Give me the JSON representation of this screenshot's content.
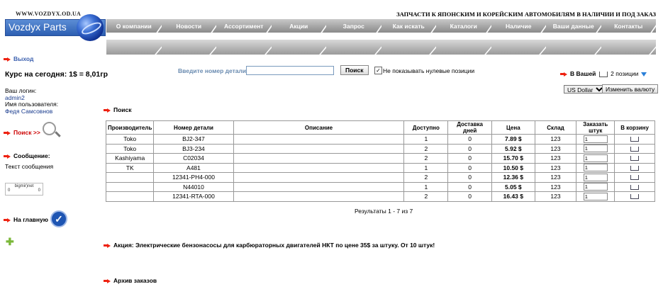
{
  "header": {
    "site_url": "WWW.VOZDYX.OD.UA",
    "tagline": "ЗАПЧАСТИ К ЯПОНСКИМ И КОРЕЙСКИМ АВТОМОБИЛЯМ В НАЛИЧИИ И ПОД ЗАКАЗ",
    "logo_text": "Vozdyx Parts"
  },
  "nav": [
    {
      "label": "О компании"
    },
    {
      "label": "Новости"
    },
    {
      "label": "Ассортимент"
    },
    {
      "label": "Акции"
    },
    {
      "label": "Запрос"
    },
    {
      "label": "Как искать"
    },
    {
      "label": "Каталоги"
    },
    {
      "label": "Наличие"
    },
    {
      "label": "Ваши данные"
    },
    {
      "label": "Контакты"
    }
  ],
  "sidebar": {
    "exit": "Выход",
    "rate": "Курс на сегодня: 1$ = 8,01гр",
    "login_label": "Ваш логин:",
    "login": "admin2",
    "user_label": "Имя пользователя:",
    "user_name": "Федя Самсовнов",
    "search_link": "Поиск >>",
    "message_title": "Сообщение:",
    "message_text": "Текст сообщения",
    "counter_name": "bigmir)net",
    "counter_left": "0",
    "counter_right": "0",
    "home_link": "На главную"
  },
  "searchbar": {
    "label": "Введите номер детали",
    "value": "",
    "button": "Поиск",
    "checkbox_label": "Не показывать нулевые позиции"
  },
  "cart": {
    "label": "В Вашей",
    "count": "2 позиции"
  },
  "currency": {
    "selected": "US Dollar",
    "button": "Изменить валюту"
  },
  "results": {
    "title": "Поиск",
    "columns": {
      "maker": "Производитель",
      "part": "Номер детали",
      "desc": "Описание",
      "avail": "Доступно",
      "delivery": "Доставка дней",
      "price": "Цена",
      "stock": "Склад",
      "order": "Заказать штук",
      "basket": "В корзину"
    },
    "rows": [
      {
        "maker": "Toko",
        "part": "BJ2-347",
        "desc": "",
        "avail": "1",
        "delivery": "0",
        "price": "7.89 $",
        "stock": "123",
        "qty": "1"
      },
      {
        "maker": "Toko",
        "part": "BJ3-234",
        "desc": "",
        "avail": "2",
        "delivery": "0",
        "price": "5.92 $",
        "stock": "123",
        "qty": "1"
      },
      {
        "maker": "Kashiyama",
        "part": "C02034",
        "desc": "",
        "avail": "2",
        "delivery": "0",
        "price": "15.70 $",
        "stock": "123",
        "qty": "1"
      },
      {
        "maker": "TK",
        "part": "A481",
        "desc": "",
        "avail": "1",
        "delivery": "0",
        "price": "10.50 $",
        "stock": "123",
        "qty": "1"
      },
      {
        "maker": "",
        "part": "12341-PH4-000",
        "desc": "",
        "avail": "2",
        "delivery": "0",
        "price": "12.36 $",
        "stock": "123",
        "qty": "1"
      },
      {
        "maker": "",
        "part": "N44010",
        "desc": "",
        "avail": "1",
        "delivery": "0",
        "price": "5.05 $",
        "stock": "123",
        "qty": "1"
      },
      {
        "maker": "",
        "part": "12341-RTA-000",
        "desc": "",
        "avail": "2",
        "delivery": "0",
        "price": "16.43 $",
        "stock": "123",
        "qty": "1"
      }
    ],
    "summary": "Результаты 1 - 7 из 7"
  },
  "promo": "Акция: Электрические бензонасосы для карбюраторных двигателей НКТ по цене 35$ за штуку. От 10 штук!",
  "archive": "Архив заказов"
}
